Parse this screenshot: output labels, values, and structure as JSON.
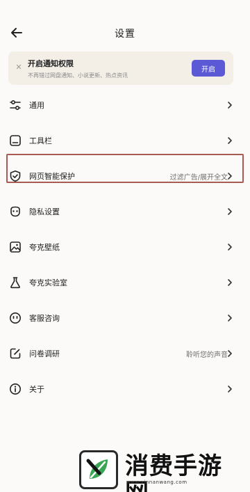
{
  "header": {
    "title": "设置",
    "back_icon": "arrow-left-icon"
  },
  "notice": {
    "close_icon": "close-icon",
    "title": "开启通知权限",
    "description": "不再错过网盘通知、小说更新、热点资讯",
    "button_label": "开启",
    "button_color": "#5b59d6"
  },
  "menu": {
    "items": [
      {
        "icon": "sliders-icon",
        "label": "通用",
        "value": ""
      },
      {
        "icon": "toolbar-icon",
        "label": "工具栏",
        "value": ""
      },
      {
        "icon": "shield-check-icon",
        "label": "网页智能保护",
        "value": "过滤广告/展开全文"
      },
      {
        "icon": "privacy-mask-icon",
        "label": "隐私设置",
        "value": ""
      },
      {
        "icon": "wallpaper-icon",
        "label": "夸克壁纸",
        "value": ""
      },
      {
        "icon": "flask-icon",
        "label": "夸克实验室",
        "value": ""
      },
      {
        "icon": "support-face-icon",
        "label": "客服咨询",
        "value": ""
      },
      {
        "icon": "survey-edit-icon",
        "label": "问卷调研",
        "value": "聆听您的声音"
      },
      {
        "icon": "info-icon",
        "label": "关于",
        "value": ""
      }
    ],
    "highlight_color": "#a85a55"
  },
  "watermark": {
    "text": "消费手游网",
    "url": "www.xinnanwang.com"
  }
}
